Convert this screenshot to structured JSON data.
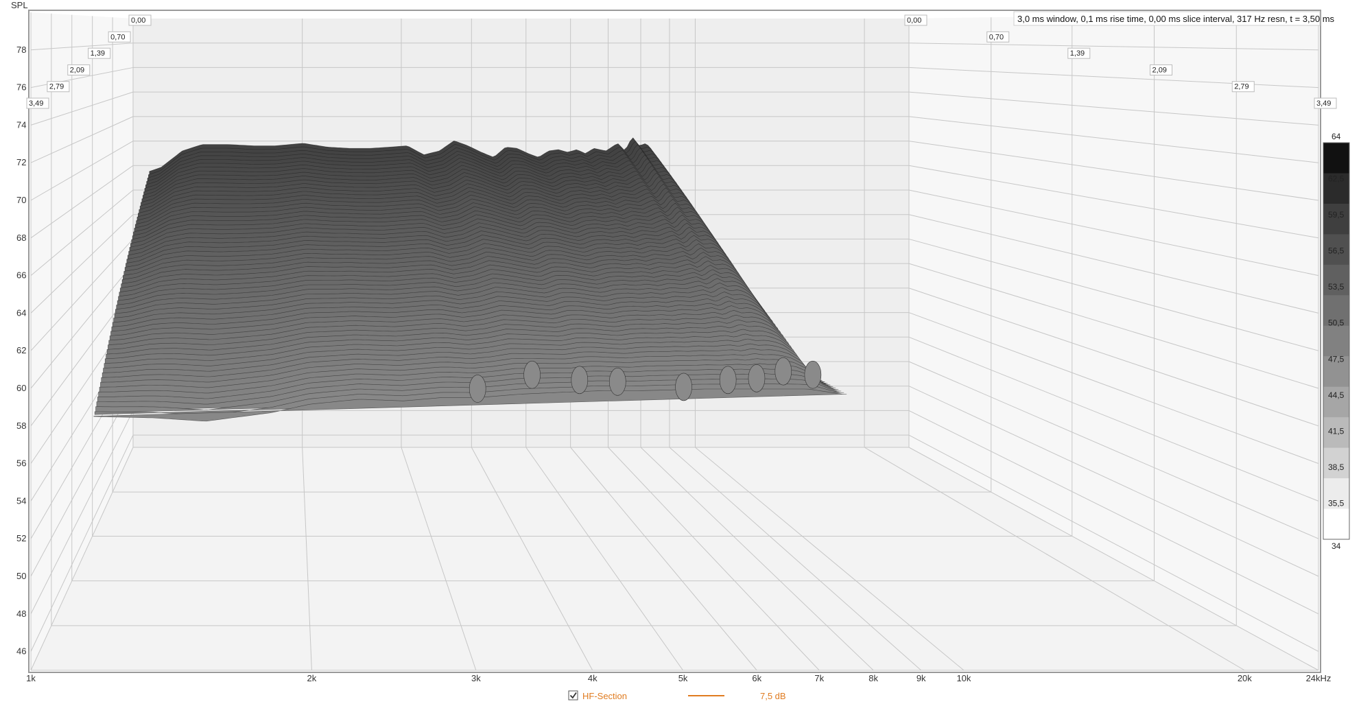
{
  "chart_data": {
    "type": "waterfall-3d",
    "info": "3,0 ms window, 0,1 ms rise time, 0,00 ms slice interval, 317 Hz resn, t = 3,50 ms",
    "ylabel": "SPL",
    "ylim": [
      45,
      80
    ],
    "yticks": [
      46,
      48,
      50,
      52,
      54,
      56,
      58,
      60,
      62,
      64,
      66,
      68,
      70,
      72,
      74,
      76,
      78
    ],
    "ytick_labels": [
      "46",
      "48",
      "50",
      "52",
      "54",
      "56",
      "58",
      "60",
      "62",
      "64",
      "66",
      "68",
      "70",
      "72",
      "74",
      "76",
      "78"
    ],
    "xscale": "log",
    "xlim": [
      1000,
      24000
    ],
    "xticks": [
      1000,
      2000,
      3000,
      4000,
      5000,
      6000,
      7000,
      8000,
      9000,
      10000,
      20000,
      24000
    ],
    "xtick_labels": [
      "1k",
      "2k",
      "3k",
      "4k",
      "5k",
      "6k",
      "7k",
      "8k",
      "9k",
      "10k",
      "20k",
      "24kHz"
    ],
    "time_axis_ms": [
      0.0,
      0.7,
      1.39,
      2.09,
      2.79,
      3.49
    ],
    "time_labels": [
      "0,00",
      "0,70",
      "1,39",
      "2,09",
      "2,79",
      "3,49"
    ],
    "colorscale": {
      "min": 34,
      "max": 64,
      "labels": [
        "64",
        "62,5",
        "59,5",
        "56,5",
        "53,5",
        "50,5",
        "47,5",
        "44,5",
        "41,5",
        "38,5",
        "35,5",
        "34"
      ],
      "colors": [
        "#111111",
        "#2b2b2b",
        "#3f3f3f",
        "#505050",
        "#606060",
        "#707070",
        "#818181",
        "#929292",
        "#a6a6a6",
        "#bababa",
        "#d2d2d2",
        "#ececec",
        "#ffffff"
      ]
    },
    "profile_first_slice": [
      [
        1100,
        68.0
      ],
      [
        1150,
        68.3
      ],
      [
        1250,
        69.6
      ],
      [
        1350,
        70.1
      ],
      [
        1500,
        70.1
      ],
      [
        1650,
        70.0
      ],
      [
        1800,
        70.0
      ],
      [
        2000,
        70.2
      ],
      [
        2200,
        69.9
      ],
      [
        2400,
        69.8
      ],
      [
        2600,
        69.8
      ],
      [
        2800,
        69.9
      ],
      [
        3000,
        70.0
      ],
      [
        3200,
        69.3
      ],
      [
        3400,
        69.6
      ],
      [
        3600,
        70.4
      ],
      [
        3800,
        70.0
      ],
      [
        4000,
        69.5
      ],
      [
        4200,
        69.1
      ],
      [
        4400,
        69.9
      ],
      [
        4600,
        69.8
      ],
      [
        4800,
        69.4
      ],
      [
        5000,
        69.1
      ],
      [
        5200,
        69.6
      ],
      [
        5400,
        69.7
      ],
      [
        5600,
        69.5
      ],
      [
        5800,
        69.7
      ],
      [
        6000,
        69.4
      ],
      [
        6200,
        69.8
      ],
      [
        6500,
        69.6
      ],
      [
        6800,
        70.2
      ],
      [
        7000,
        69.6
      ],
      [
        7200,
        70.7
      ],
      [
        7400,
        70.0
      ],
      [
        7600,
        70.2
      ],
      [
        7800,
        69.6
      ],
      [
        8000,
        68.5
      ],
      [
        8300,
        66.0
      ],
      [
        8600,
        60.0
      ],
      [
        8900,
        56.8
      ]
    ],
    "profile_last_slice": [
      [
        1050,
        56.3
      ],
      [
        1300,
        56.2
      ],
      [
        1500,
        56.0
      ],
      [
        1800,
        56.5
      ],
      [
        2000,
        57.0
      ],
      [
        2300,
        57.3
      ],
      [
        2600,
        57.2
      ],
      [
        2900,
        57.4
      ],
      [
        3200,
        57.4
      ],
      [
        3600,
        57.6
      ],
      [
        4000,
        57.7
      ],
      [
        4500,
        57.8
      ],
      [
        5000,
        57.8
      ],
      [
        6000,
        57.9
      ],
      [
        7000,
        57.9
      ],
      [
        8000,
        57.9
      ],
      [
        8800,
        57.6
      ]
    ],
    "bumps": [
      [
        3150,
        58.4
      ],
      [
        3650,
        59.2
      ],
      [
        4150,
        58.9
      ],
      [
        4600,
        58.8
      ],
      [
        5500,
        58.5
      ],
      [
        6200,
        58.9
      ],
      [
        6700,
        59.0
      ],
      [
        7200,
        59.4
      ],
      [
        7800,
        59.2
      ]
    ]
  },
  "legend": {
    "checkbox_label": "HF-Section",
    "checked": true,
    "value_label": "7,5 dB",
    "color": "#e07b1f"
  }
}
